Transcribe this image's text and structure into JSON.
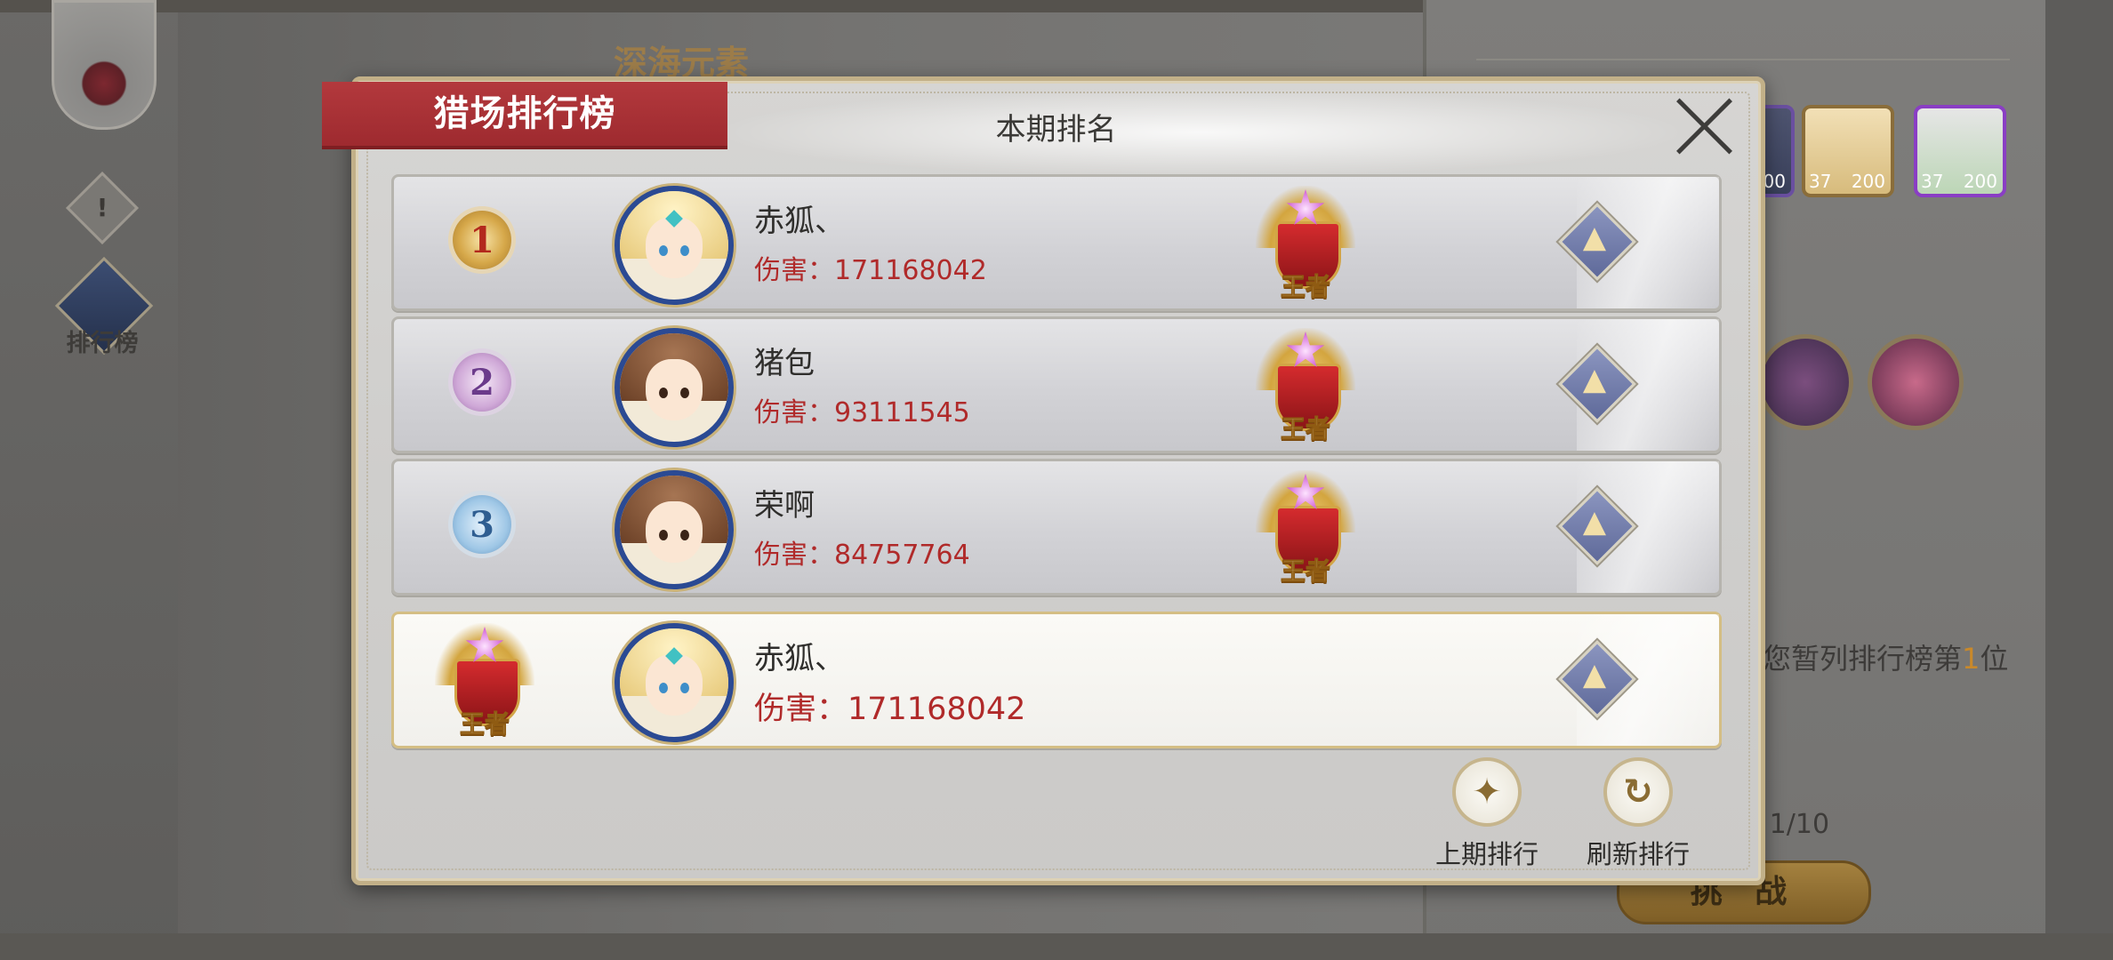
{
  "background": {
    "sidebar_label": "排行榜",
    "event_title": "深海元素",
    "hero_cards": [
      {
        "level": "37",
        "count": "200"
      },
      {
        "level": "37",
        "count": "200"
      }
    ],
    "hero_card_partial_count": "00",
    "rank_line_prefix": "您暂列排行榜第",
    "rank_line_number": "1",
    "rank_line_suffix": "位",
    "attempts_label": ":",
    "attempts_value": "1/10",
    "challenge_label": "挑 战"
  },
  "modal": {
    "title": "猎场排行榜",
    "subtitle": "本期排名",
    "rows": [
      {
        "rank": "1",
        "name": "赤狐、",
        "damage": "伤害：171168042",
        "tier": "王者",
        "avatar": "blonde"
      },
      {
        "rank": "2",
        "name": "猪包",
        "damage": "伤害：93111545",
        "tier": "王者",
        "avatar": "brown"
      },
      {
        "rank": "3",
        "name": "荣啊",
        "damage": "伤害：84757764",
        "tier": "王者",
        "avatar": "brown"
      }
    ],
    "self_row": {
      "name": "赤狐、",
      "damage": "伤害：171168042",
      "tier": "王者",
      "avatar": "blonde"
    },
    "buttons": {
      "previous_label": "上期排行",
      "refresh_label": "刷新排行"
    }
  },
  "icons": {
    "close": "close-icon",
    "like": "like-icon",
    "previous": "previous-ranking-icon",
    "refresh": "refresh-icon"
  },
  "colors": {
    "title_tab": "#a8303a",
    "damage_text": "#b02a2a",
    "avatar_ring": "#2b4a93"
  }
}
